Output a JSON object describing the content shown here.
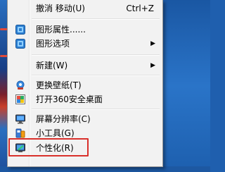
{
  "menu": {
    "items": [
      {
        "label": "撤消 移动(U)",
        "shortcut": "Ctrl+Z",
        "icon": "none",
        "submenu": false
      },
      {
        "label": "图形属性......",
        "shortcut": "",
        "icon": "graphics-properties-icon",
        "submenu": false
      },
      {
        "label": "图形选项",
        "shortcut": "",
        "icon": "graphics-options-icon",
        "submenu": true
      },
      {
        "label": "新建(W)",
        "shortcut": "",
        "icon": "none",
        "submenu": true
      },
      {
        "label": "更换壁纸(T)",
        "shortcut": "",
        "icon": "change-wallpaper-icon",
        "submenu": false
      },
      {
        "label": "打开360安全桌面",
        "shortcut": "",
        "icon": "360-desktop-icon",
        "submenu": false
      },
      {
        "label": "屏幕分辨率(C)",
        "shortcut": "",
        "icon": "screen-resolution-icon",
        "submenu": false
      },
      {
        "label": "小工具(G)",
        "shortcut": "",
        "icon": "gadgets-icon",
        "submenu": false
      },
      {
        "label": "个性化(R)",
        "shortcut": "",
        "icon": "personalize-icon",
        "submenu": false
      }
    ],
    "submenu_arrow": "▶"
  },
  "colors": {
    "menu_bg": "#f2f2f2",
    "highlight": "#d9302b"
  }
}
